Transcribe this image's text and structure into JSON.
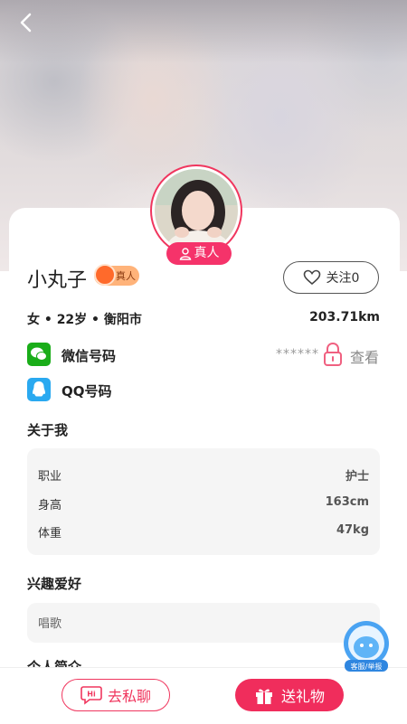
{
  "profile": {
    "name": "小丸子",
    "badge_text": "真人",
    "real_tag": "真人",
    "follow_label": "关注0",
    "info": "女 • 22岁 • 衡阳市",
    "distance": "203.71km"
  },
  "contacts": {
    "wechat_label": "微信号码",
    "wechat_mask": "******",
    "view_label": "查看",
    "qq_label": "QQ号码"
  },
  "about": {
    "title": "关于我",
    "rows": [
      {
        "label": "职业",
        "value": "护士"
      },
      {
        "label": "身高",
        "value": "163cm"
      },
      {
        "label": "体重",
        "value": "47kg"
      }
    ]
  },
  "hobbies": {
    "title": "兴趣爱好",
    "value": "唱歌"
  },
  "next_section_title": "个人简介",
  "assistant_label": "客服/举报",
  "actions": {
    "chat_label": "去私聊",
    "chat_icon_text": "Hi",
    "gift_label": "送礼物"
  },
  "colors": {
    "accent": "#f0365e",
    "wechat": "#1aad19",
    "qq": "#2aa9f0"
  },
  "icons": [
    "back-arrow-icon",
    "person-icon",
    "heart-icon",
    "wechat-icon",
    "lock-icon",
    "qq-icon",
    "hi-bubble-icon",
    "gift-icon",
    "assistant-icon"
  ]
}
